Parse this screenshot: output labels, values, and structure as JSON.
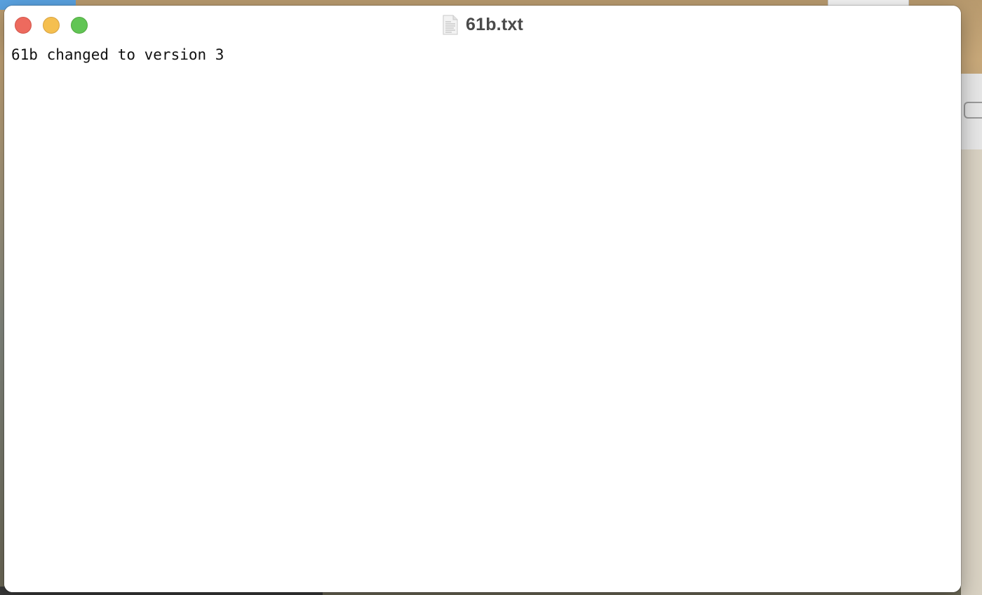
{
  "window": {
    "title": "61b.txt",
    "file_icon": "text-document-icon"
  },
  "traffic_lights": {
    "close_color": "#ed6a5e",
    "minimize_color": "#f5bf4f",
    "zoom_color": "#61c554"
  },
  "document": {
    "content": "61b changed to version 3"
  }
}
